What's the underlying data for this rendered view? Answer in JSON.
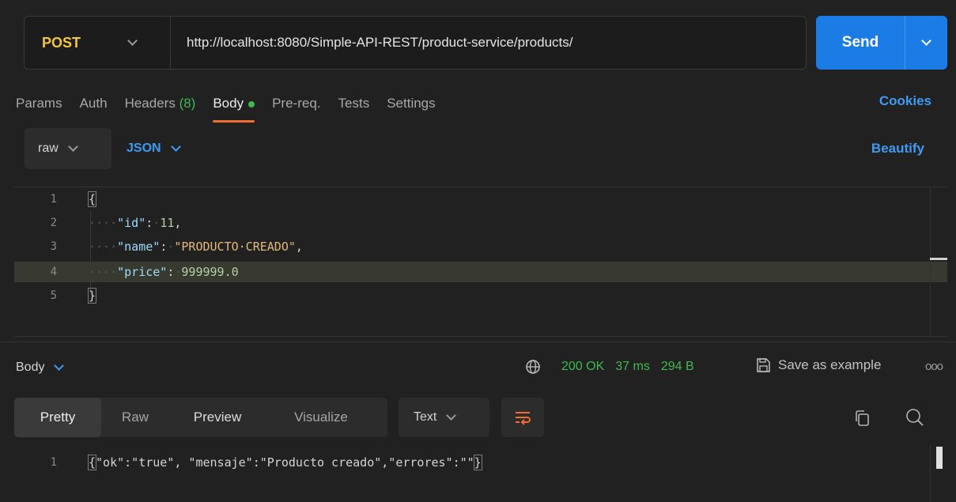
{
  "request": {
    "method": "POST",
    "url": "http://localhost:8080/Simple-API-REST/product-service/products/",
    "send_label": "Send"
  },
  "request_tabs": {
    "params": "Params",
    "auth": "Auth",
    "headers": "Headers",
    "headers_count": "(8)",
    "body": "Body",
    "prereq": "Pre-req.",
    "tests": "Tests",
    "settings": "Settings",
    "cookies": "Cookies"
  },
  "body_options": {
    "mode": "raw",
    "language": "JSON",
    "beautify": "Beautify"
  },
  "editor": {
    "line_numbers": [
      "1",
      "2",
      "3",
      "4",
      "5"
    ],
    "open_brace": "{",
    "close_brace": "}",
    "id_key": "\"id\"",
    "id_value": "11",
    "name_key": "\"name\"",
    "name_value": "\"PRODUCTO·CREADO\"",
    "price_key": "\"price\"",
    "price_value": "999999.0"
  },
  "response": {
    "body_label": "Body",
    "status": "200 OK",
    "time": "37 ms",
    "size": "294 B",
    "save_example": "Save as example",
    "more": "ooo",
    "view_tabs": [
      "Pretty",
      "Raw",
      "Preview",
      "Visualize"
    ],
    "format": "Text",
    "line_number": "1",
    "content": "\"ok\":\"true\", \"mensaje\":\"Producto creado\",\"errores\":\"\""
  },
  "colors": {
    "background": "#212121",
    "accent_blue": "#1c7ce6",
    "method_post": "#f3c746",
    "status_ok": "#3fb950",
    "active_tab_underline": "#ef6c33"
  },
  "icons": {
    "method_dropdown": "chevron-down-icon",
    "send_dropdown": "chevron-down-icon",
    "network": "globe-icon",
    "save": "save-icon",
    "wrap": "wrap-lines-icon",
    "copy": "copy-icon",
    "search": "search-icon"
  }
}
